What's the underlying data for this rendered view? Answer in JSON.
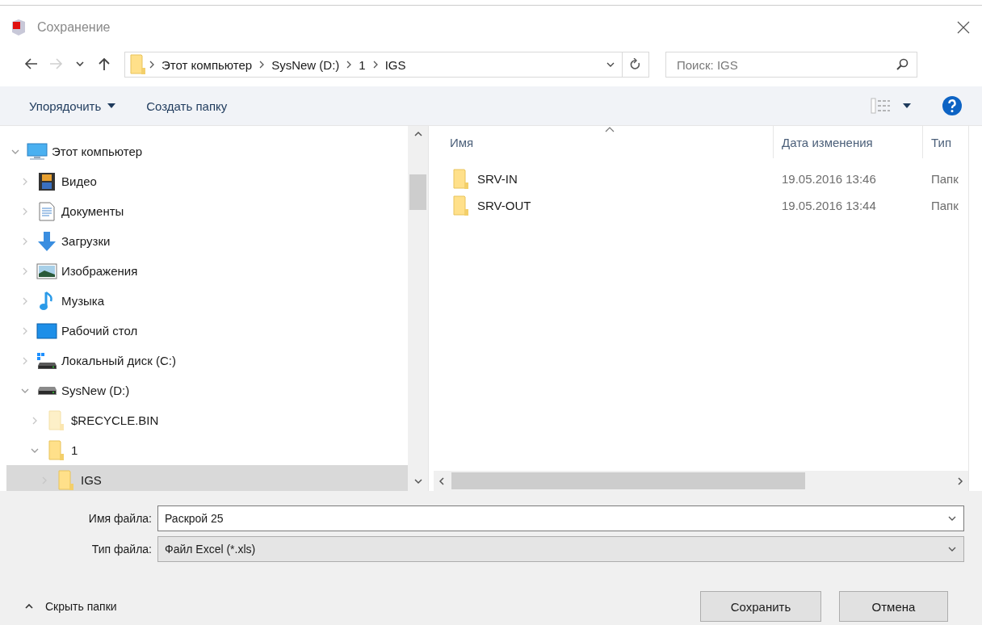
{
  "window": {
    "title": "Сохранение"
  },
  "navigation": {
    "buttons": [
      {
        "kind": "back",
        "disabled": false
      },
      {
        "kind": "forward",
        "disabled": true
      },
      {
        "kind": "recent",
        "disabled": false
      },
      {
        "kind": "up",
        "disabled": false
      }
    ],
    "breadcrumb": [
      "Этот компьютер",
      "SysNew (D:)",
      "1",
      "IGS"
    ],
    "search": {
      "placeholder": "Поиск: IGS"
    }
  },
  "toolbar": {
    "organize": "Упорядочить",
    "new_folder": "Создать папку"
  },
  "tree": {
    "items": [
      {
        "label": "Этот компьютер",
        "kind": "computer",
        "expanded": true,
        "selected": false,
        "children": [
          {
            "label": "Видео",
            "kind": "video",
            "expanded": false,
            "selected": false
          },
          {
            "label": "Документы",
            "kind": "documents",
            "expanded": false,
            "selected": false
          },
          {
            "label": "Загрузки",
            "kind": "downloads",
            "expanded": false,
            "selected": false
          },
          {
            "label": "Изображения",
            "kind": "pictures",
            "expanded": false,
            "selected": false
          },
          {
            "label": "Музыка",
            "kind": "music",
            "expanded": false,
            "selected": false
          },
          {
            "label": "Рабочий стол",
            "kind": "desktop",
            "expanded": false,
            "selected": false
          },
          {
            "label": "Локальный диск (C:)",
            "kind": "system-drive",
            "expanded": false,
            "selected": false
          },
          {
            "label": "SysNew (D:)",
            "kind": "drive",
            "expanded": true,
            "selected": false,
            "children": [
              {
                "label": "$RECYCLE.BIN",
                "kind": "hidden-folder",
                "expanded": false,
                "selected": false
              },
              {
                "label": "1",
                "kind": "folder",
                "expanded": true,
                "selected": false,
                "children": [
                  {
                    "label": "IGS",
                    "kind": "folder",
                    "expanded": false,
                    "selected": true
                  }
                ]
              }
            ]
          }
        ]
      }
    ]
  },
  "table": {
    "columns": [
      {
        "label": "Имя",
        "sorted": true
      },
      {
        "label": "Дата изменения",
        "sorted": false
      },
      {
        "label": "Тип",
        "sorted": false
      }
    ],
    "rows": [
      {
        "name": "SRV-IN",
        "date": "19.05.2016 13:46",
        "type": "Папк"
      },
      {
        "name": "SRV-OUT",
        "date": "19.05.2016 13:44",
        "type": "Папк"
      }
    ]
  },
  "form": {
    "file_name": {
      "label": "Имя файла:",
      "value": "Раскрой 25"
    },
    "file_type": {
      "label": "Тип файла:",
      "value": "Файл Excel (*.xls)"
    }
  },
  "footer": {
    "hide_folders": "Скрыть папки",
    "buttons": [
      "Сохранить",
      "Отмена"
    ]
  }
}
